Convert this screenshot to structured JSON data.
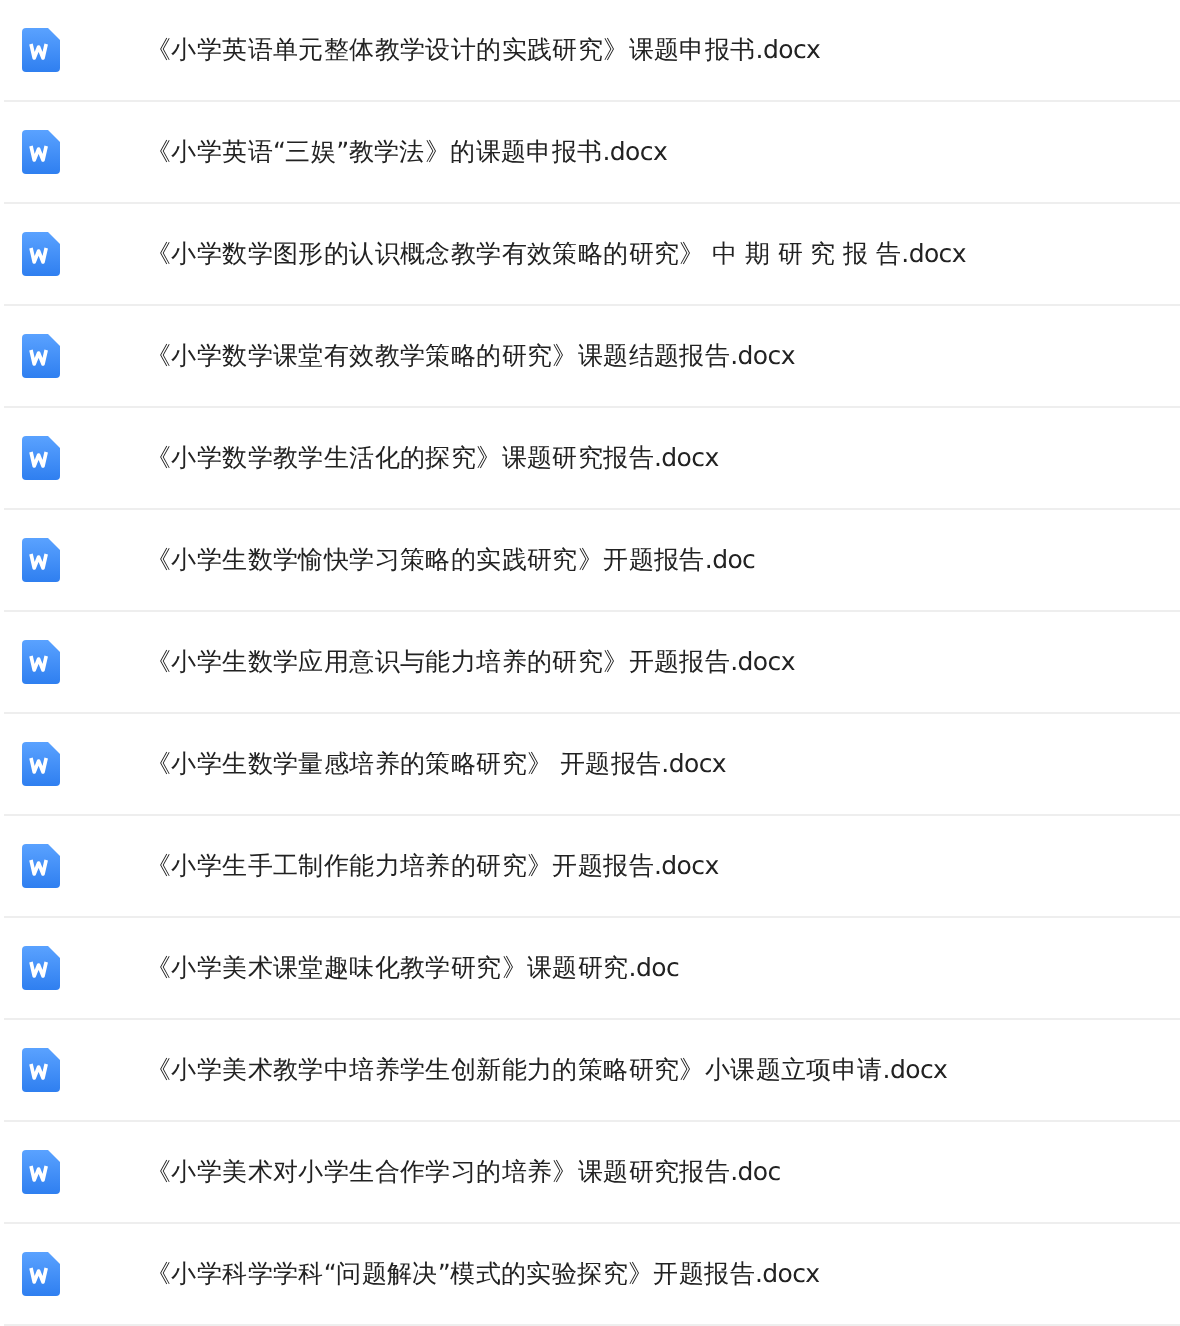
{
  "files": [
    {
      "name": "《小学英语单元整体教学设计的实践研究》课题申报书.docx"
    },
    {
      "name": "《小学英语“三娱”教学法》的课题申报书.docx"
    },
    {
      "name": "《小学数学图形的认识概念教学有效策略的研究》 中 期 研 究 报 告.docx"
    },
    {
      "name": "《小学数学课堂有效教学策略的研究》课题结题报告.docx"
    },
    {
      "name": "《小学数学教学生活化的探究》课题研究报告.docx"
    },
    {
      "name": "《小学生数学愉快学习策略的实践研究》开题报告.doc"
    },
    {
      "name": "《小学生数学应用意识与能力培养的研究》开题报告.docx"
    },
    {
      "name": "《小学生数学量感培养的策略研究》 开题报告.docx"
    },
    {
      "name": "《小学生手工制作能力培养的研究》开题报告.docx"
    },
    {
      "name": "《小学美术课堂趣味化教学研究》课题研究.doc"
    },
    {
      "name": "《小学美术教学中培养学生创新能力的策略研究》小课题立项申请.docx"
    },
    {
      "name": "《小学美术对小学生合作学习的培养》课题研究报告.doc"
    },
    {
      "name": "《小学科学学科“问题解决”模式的实验探究》开题报告.docx"
    }
  ]
}
